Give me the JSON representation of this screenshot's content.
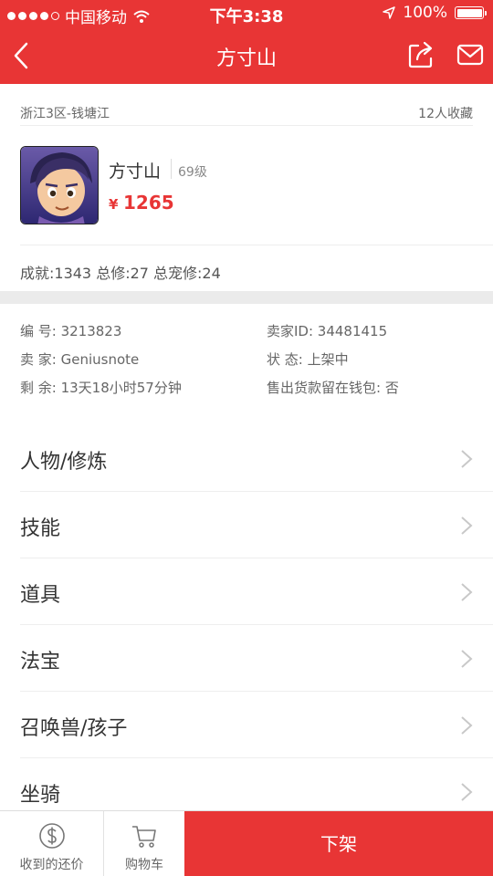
{
  "status_bar": {
    "carrier": "中国移动",
    "time": "下午3:38",
    "battery": "100%"
  },
  "nav": {
    "title": "方寸山"
  },
  "listing": {
    "server": "浙江3区-钱塘江",
    "favorites": "12人收藏",
    "char_name": "方寸山",
    "level": "69级",
    "price_symbol": "¥",
    "price": "1265",
    "achievements": "成就:1343 总修:27 总宠修:24"
  },
  "info": {
    "id": "编  号: 3213823",
    "seller": "卖  家: Geniusnote",
    "remaining": "剩  余: 13天18小时57分钟",
    "seller_id": "卖家ID: 34481415",
    "status": "状  态: 上架中",
    "wallet": "售出货款留在钱包: 否"
  },
  "menu": [
    {
      "label": "人物/修炼"
    },
    {
      "label": "技能"
    },
    {
      "label": "道具"
    },
    {
      "label": "法宝"
    },
    {
      "label": "召唤兽/孩子"
    },
    {
      "label": "坐骑"
    }
  ],
  "bottom": {
    "offers_label": "收到的还价",
    "cart_label": "购物车",
    "delist_label": "下架"
  },
  "colors": {
    "accent": "#e83535"
  }
}
